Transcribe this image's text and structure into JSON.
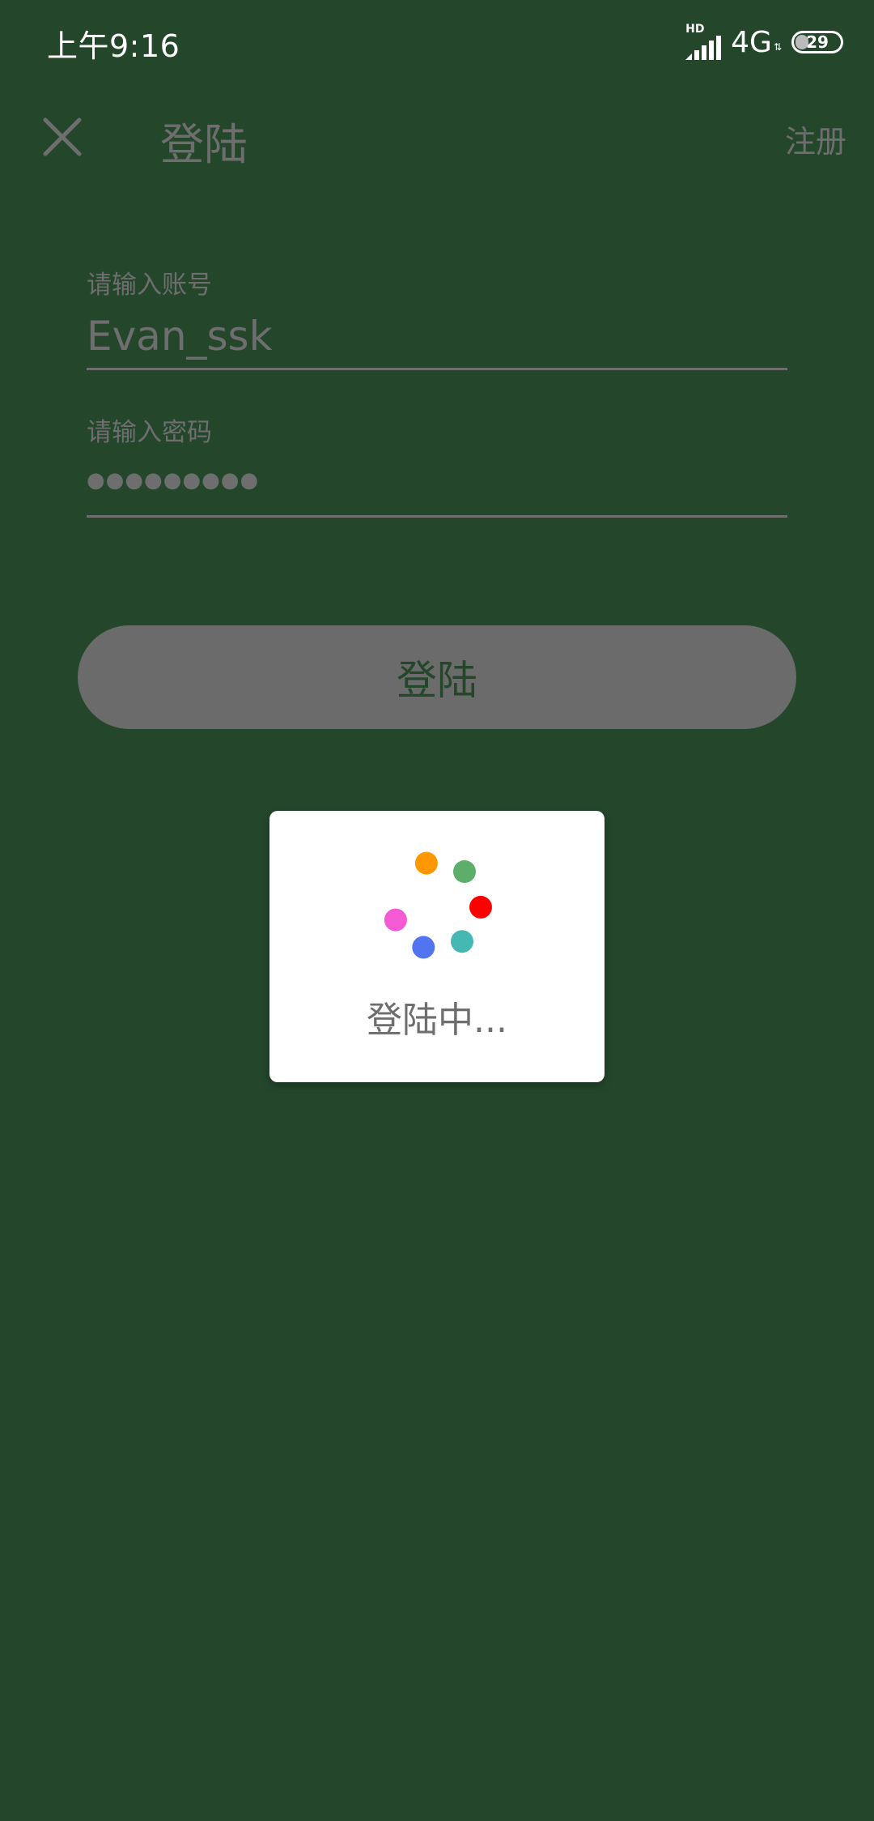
{
  "status_bar": {
    "time": "上午9:16",
    "hd_label": "HD",
    "network": "4G",
    "battery": "29",
    "battery_fraction": 0.29
  },
  "app_bar": {
    "title": "登陆",
    "register_label": "注册",
    "close_icon": "close-icon"
  },
  "form": {
    "account": {
      "label": "请输入账号",
      "value": "Evan_ssk"
    },
    "password": {
      "label": "请输入密码",
      "value": "●●●●●●●●●"
    },
    "login_button_label": "登陆"
  },
  "loading_dialog": {
    "text": "登陆中...",
    "dot_colors": [
      "#FF9800",
      "#5DAE6B",
      "#FF0000",
      "#45B8B4",
      "#5374F0",
      "#F45AD3"
    ]
  },
  "colors": {
    "background": "#24472C",
    "muted_text": "#6E6E6E",
    "button": "#6B6B6B",
    "dialog": "#FFFFFF"
  }
}
